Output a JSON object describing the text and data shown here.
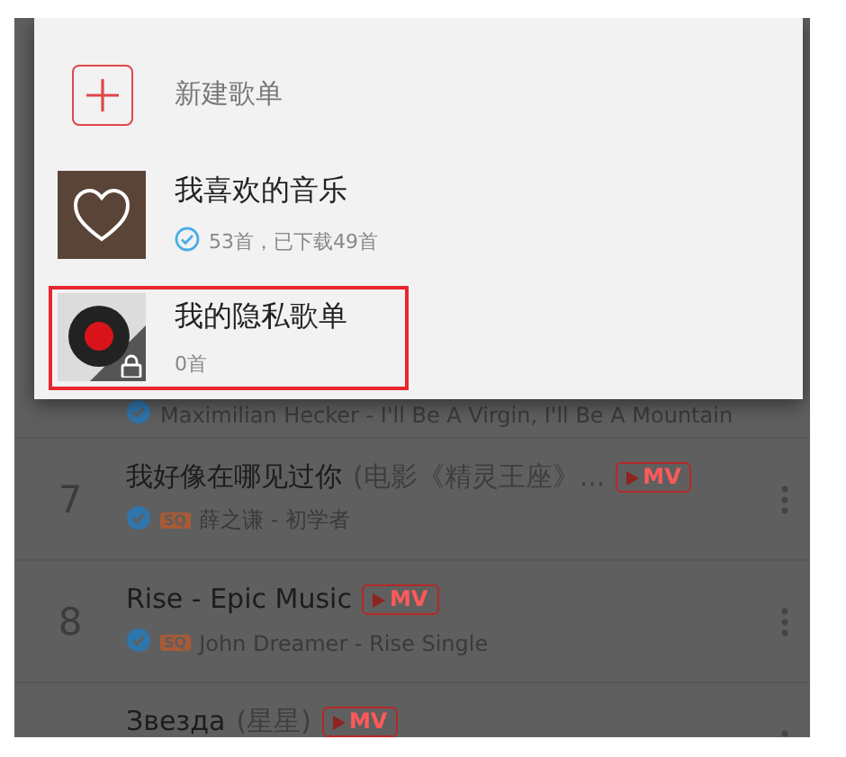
{
  "popup": {
    "items": [
      {
        "kind": "create",
        "title": "新建歌单"
      },
      {
        "kind": "favorites",
        "title": "我喜欢的音乐",
        "downloaded": true,
        "subtitle": "53首，已下载49首",
        "locked": false,
        "highlighted": false
      },
      {
        "kind": "playlist",
        "title": "我的隐私歌单",
        "downloaded": false,
        "subtitle": "0首",
        "locked": true,
        "highlighted": true
      }
    ]
  },
  "songs": [
    {
      "subtitle": "Maximilian Hecker - I'll Be A Virgin, I'll Be A Mountain",
      "downloaded": true
    },
    {
      "number": "7",
      "title": "我好像在哪见过你",
      "note": "(电影《精灵王座》...",
      "mv": "MV",
      "downloaded": true,
      "quality": "SQ",
      "subtitle": "薛之谦 - 初学者"
    },
    {
      "number": "8",
      "title": "Rise - Epic Music",
      "mv": "MV",
      "downloaded": true,
      "quality": "SQ",
      "subtitle": "John Dreamer - Rise   Single"
    },
    {
      "title": "Звезда",
      "note": "(星星)",
      "mv": "MV"
    }
  ]
}
